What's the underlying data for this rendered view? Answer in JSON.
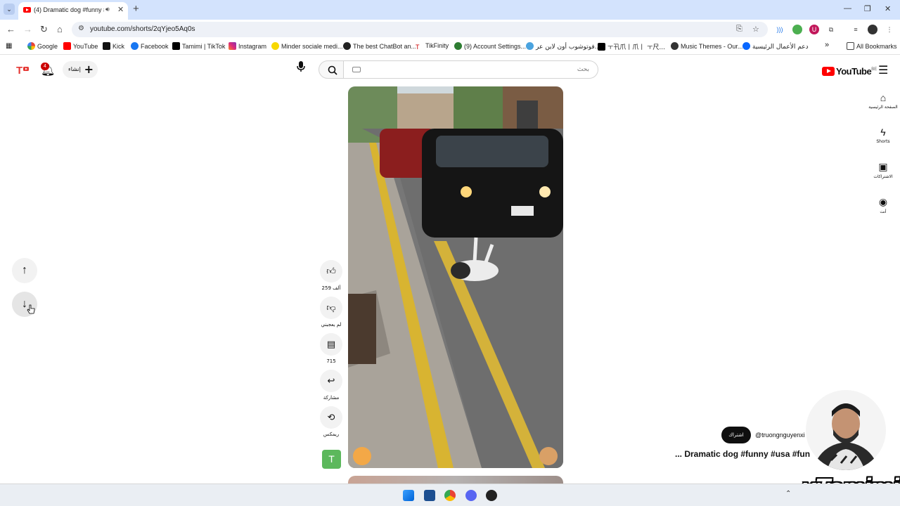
{
  "browser": {
    "tab_title": "(4) Dramatic dog #funny #usa",
    "url": "youtube.com/shorts/2qYjeo5Aq0s",
    "bookmarks": [
      "Google",
      "YouTube",
      "Kick",
      "Facebook",
      "Tamimi | TikTok",
      "Instagram",
      "Minder sociale medi...",
      "The best ChatBot an...",
      "TikFinity",
      "(9) Account Settings...",
      "فوتوشوب أون لاين عر...",
      "ㅜ卂爪丨爪丨 ㅜ尺...",
      "Music Themes - Our...",
      "دعم الأعمال الرئيسية"
    ],
    "all_bookmarks": "All Bookmarks"
  },
  "header": {
    "logo": "YouTube",
    "region": "BE",
    "search_placeholder": "بحث",
    "create_label": "إنشاء",
    "notification_count": "4"
  },
  "guide": {
    "home": "الصفحة الرئيسية",
    "shorts": "Shorts",
    "subscriptions": "الاشتراكات",
    "you": "أنت"
  },
  "actions": {
    "likes": "259 ألف",
    "dislike": "لم يعجبني",
    "comments": "715",
    "share": "مشاركة",
    "remix": "ريمكس",
    "channel_initial": "T"
  },
  "meta": {
    "subscribe": "اشتراك",
    "handle": "@truongnguyenxi",
    "title": "... Dramatic dog #funny #usa #fun"
  },
  "overlay": {
    "watermark": "xTamimi"
  },
  "colors": {
    "youtube_red": "#ff0000",
    "tab_strip": "#d3e3fd",
    "subscribe_bg": "#0f0f0f"
  }
}
